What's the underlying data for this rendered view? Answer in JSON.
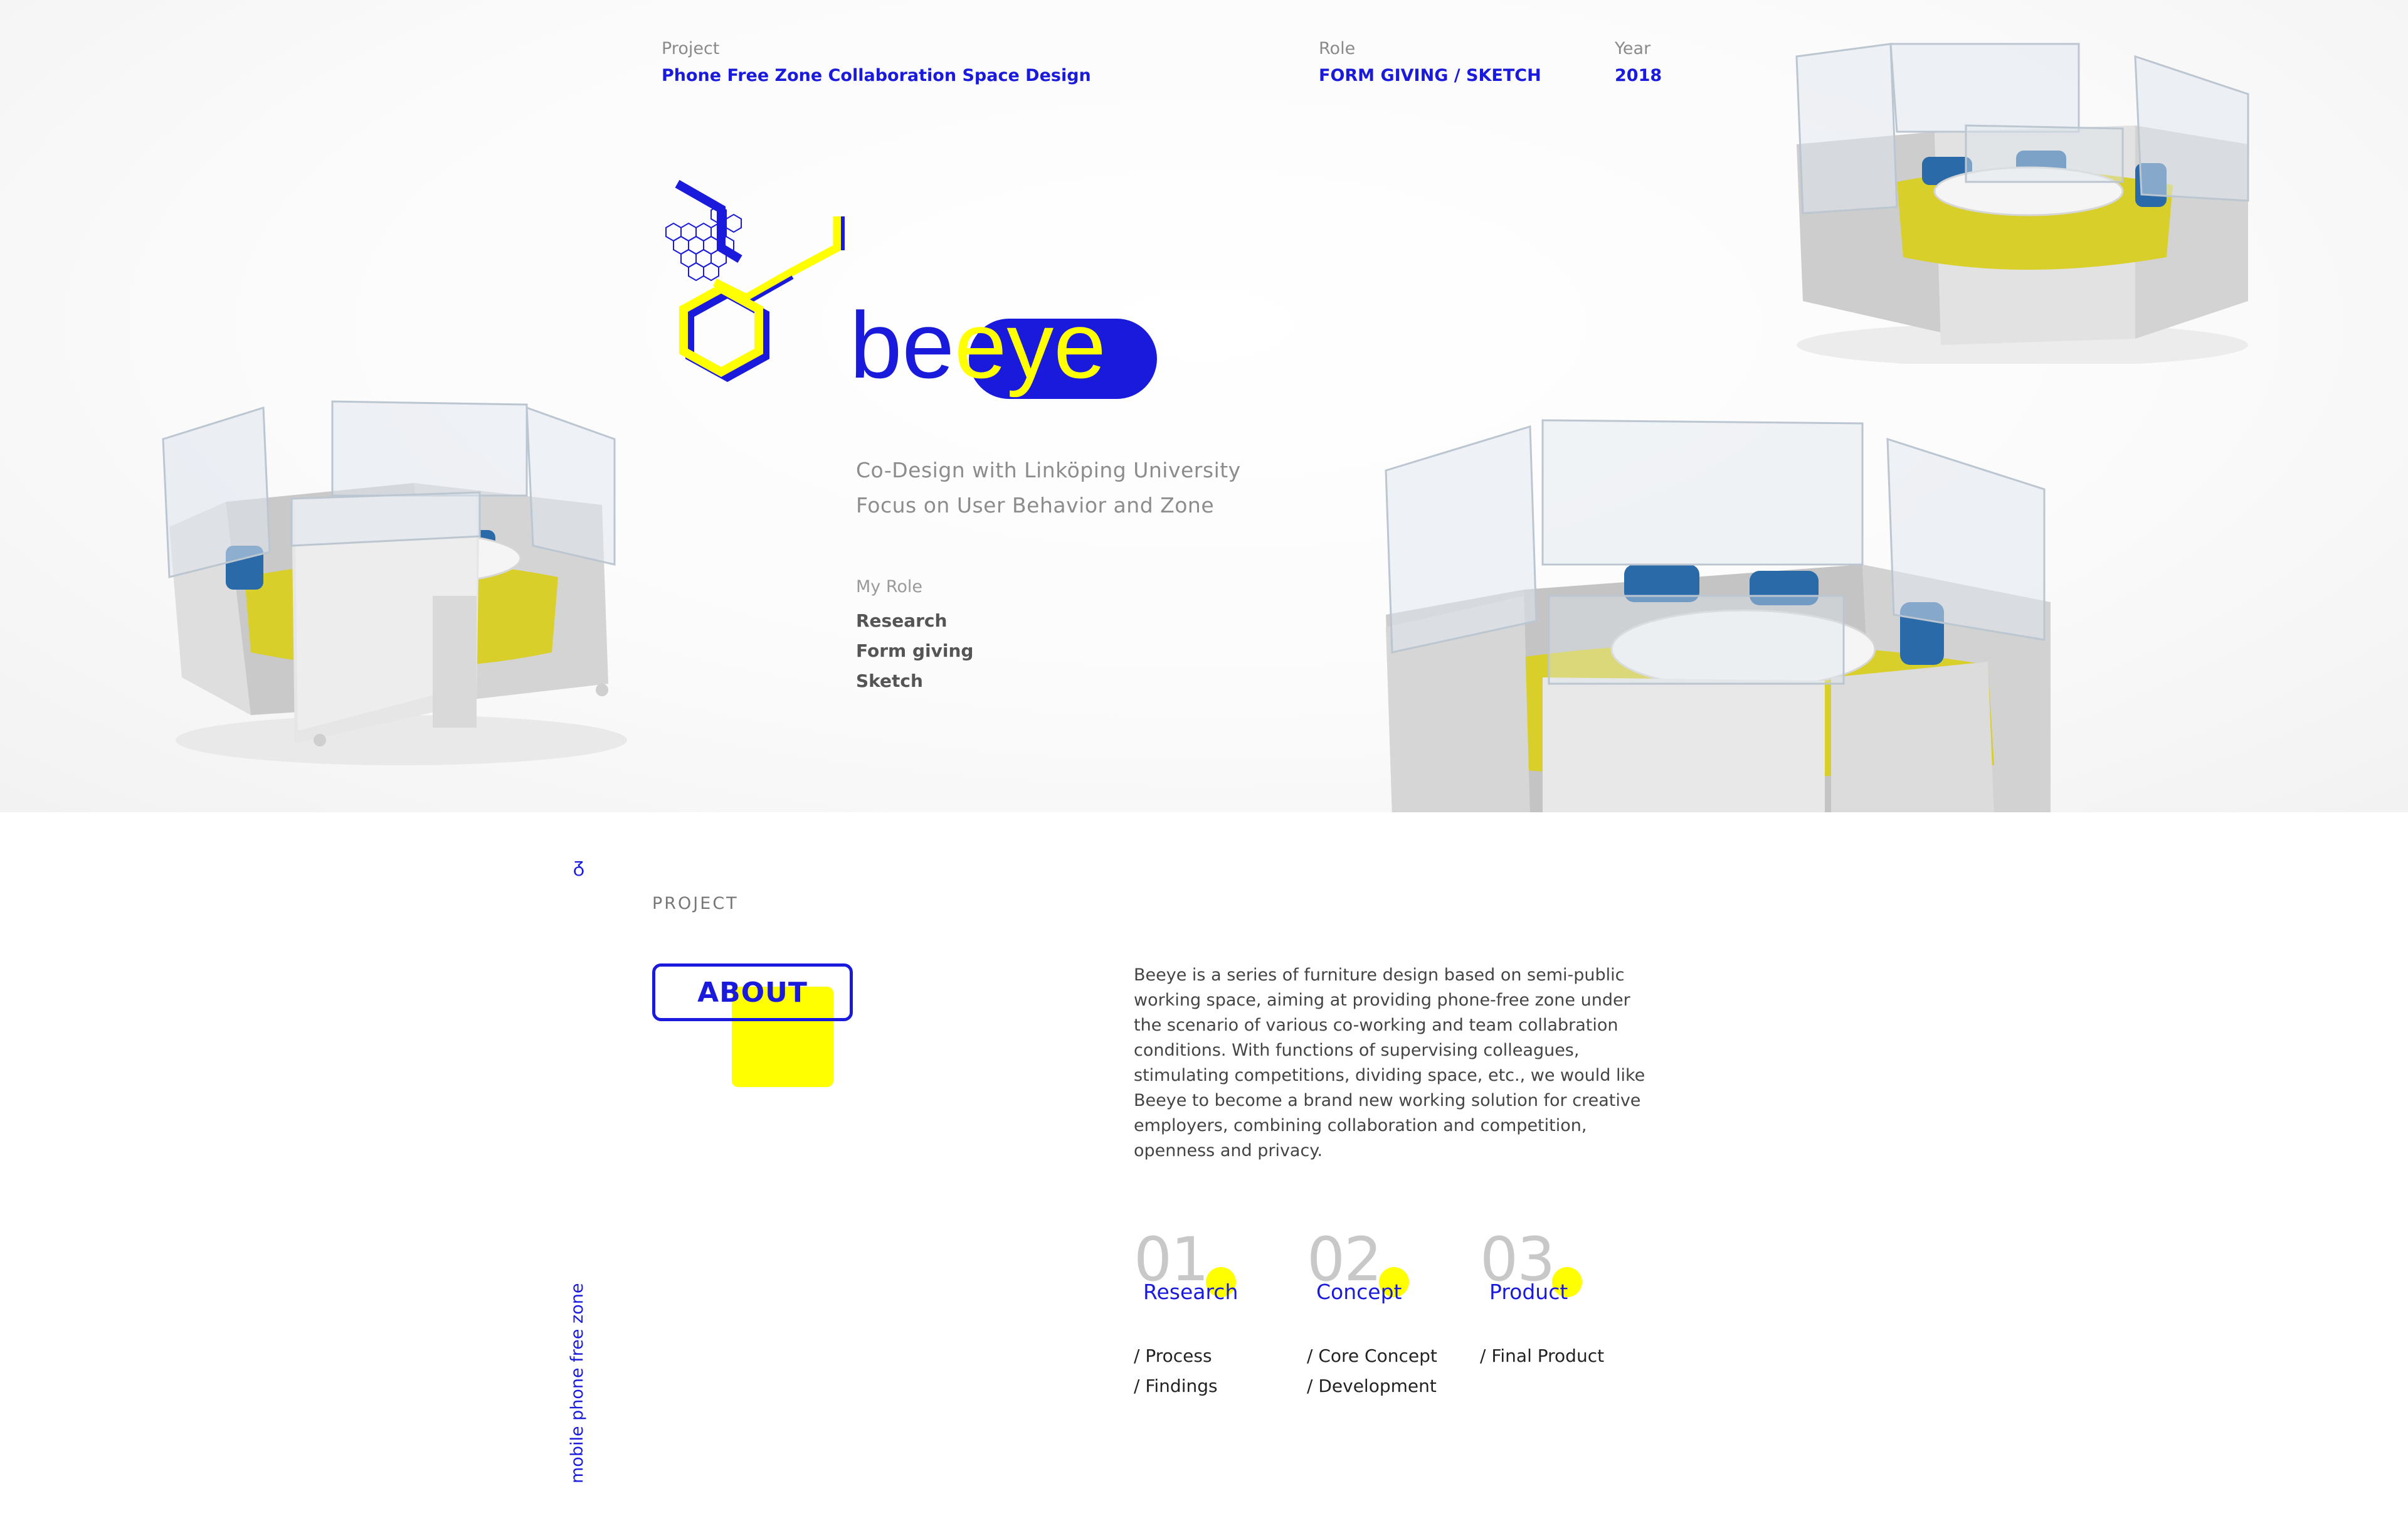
{
  "header": {
    "project_label": "Project",
    "project_value": "Phone Free Zone Collaboration Space Design",
    "role_label": "Role",
    "role_value": "FORM GIVING / SKETCH",
    "year_label": "Year",
    "year_value": "2018"
  },
  "brand": {
    "wordmark_prefix": "be",
    "wordmark_highlight": "eye"
  },
  "intro": {
    "tagline_line1": "Co-Design with Linköping University",
    "tagline_line2": "Focus on User Behavior and Zone",
    "my_role_label": "My Role",
    "roles": [
      "Research",
      "Form giving",
      "Sketch"
    ]
  },
  "about": {
    "eyebrow": "PROJECT",
    "title": "ABOUT",
    "paragraph": [
      "Beeye is a series of furniture design based on semi-public",
      "working space, aiming at providing phone-free zone under",
      "the scenario of various co-working and team collabration",
      "conditions.  With functions of supervising colleagues,",
      "stimulating competitions, dividing space, etc., we would like",
      "Beeye to become a brand new working solution for creative",
      "employers, combining collaboration and competition,",
      "openness and privacy."
    ]
  },
  "steps": [
    {
      "number": "01",
      "title": "Research",
      "links": [
        "/ Process",
        "/ Findings"
      ]
    },
    {
      "number": "02",
      "title": "Concept",
      "links": [
        "/ Core Concept",
        "/ Development"
      ]
    },
    {
      "number": "03",
      "title": "Product",
      "links": [
        "/ Final Product"
      ]
    }
  ],
  "side_label": "mobile phone free zone",
  "colors": {
    "brand_blue": "#1a1adc",
    "brand_yellow": "#ffff00",
    "fabric_yellow": "#d8cf2a",
    "cushion_blue": "#2a6aa8"
  }
}
